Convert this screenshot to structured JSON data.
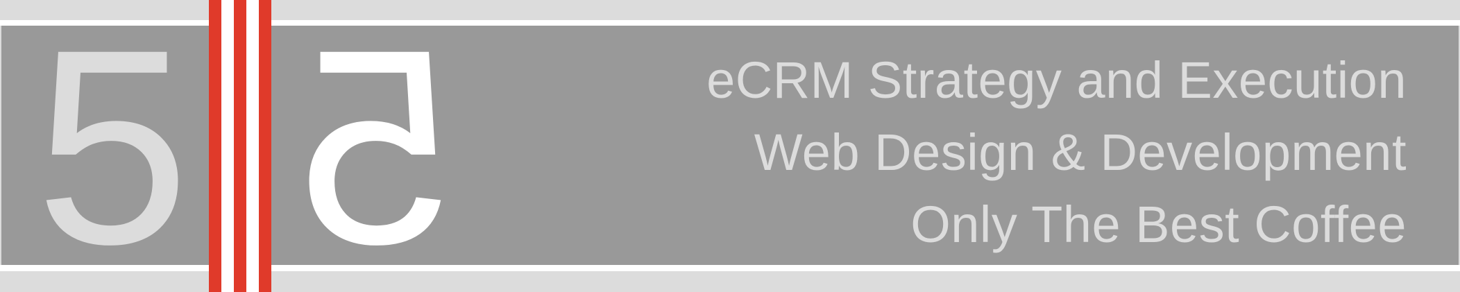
{
  "logo": {
    "digit": "5",
    "mirrored_digit": "5",
    "colors": {
      "grey_digit": "#dcdcdc",
      "white_digit": "#ffffff",
      "stripe_red": "#e03a2a",
      "stripe_white": "#ffffff",
      "band": "#999999",
      "background": "#dcdcdc"
    }
  },
  "taglines": [
    "eCRM Strategy and Execution",
    "Web Design & Development",
    "Only The Best Coffee"
  ]
}
